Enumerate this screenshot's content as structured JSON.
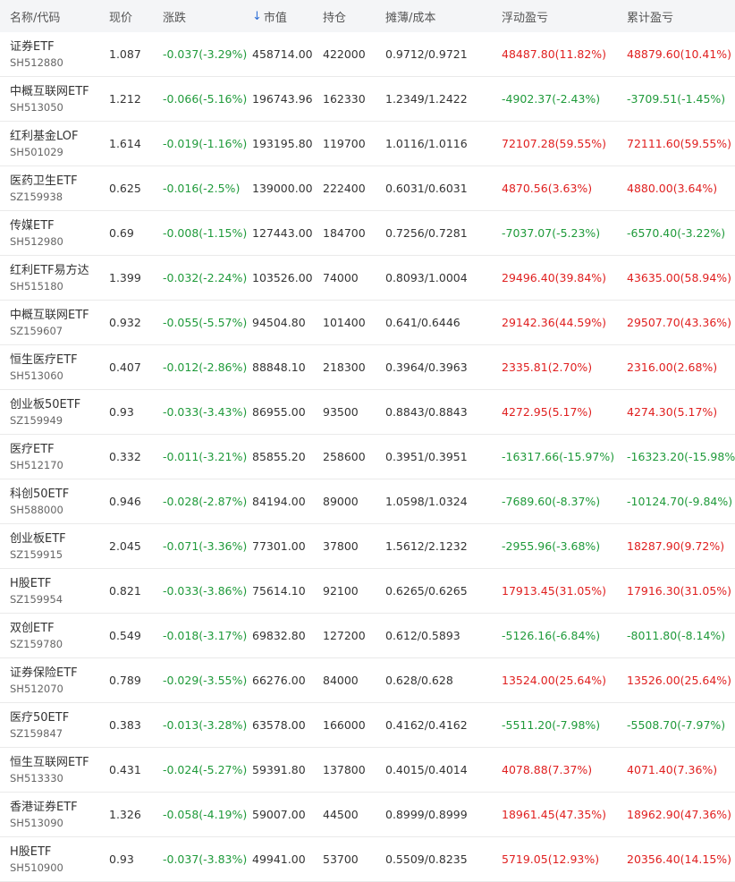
{
  "columns": [
    {
      "key": "name",
      "label": "名称/代码"
    },
    {
      "key": "price",
      "label": "现价"
    },
    {
      "key": "change",
      "label": "涨跌"
    },
    {
      "key": "market_value",
      "label": "市值"
    },
    {
      "key": "holding",
      "label": "持仓"
    },
    {
      "key": "cost",
      "label": "摊薄/成本"
    },
    {
      "key": "float_pnl",
      "label": "浮动盈亏"
    },
    {
      "key": "total_pnl",
      "label": "累计盈亏"
    }
  ],
  "sort": {
    "column": "market_value",
    "arrow": "↓"
  },
  "colors": {
    "up": "#e02020",
    "down": "#1f9a3a",
    "header_bg": "#f4f5f7"
  },
  "rows": [
    {
      "name": "证券ETF",
      "code": "SH512880",
      "price": "1.087",
      "change": "-0.037(-3.29%)",
      "market_value": "458714.00",
      "holding": "422000",
      "cost": "0.9712/0.9721",
      "float_pnl": "48487.80(11.82%)",
      "total_pnl": "48879.60(10.41%)"
    },
    {
      "name": "中概互联网ETF",
      "code": "SH513050",
      "price": "1.212",
      "change": "-0.066(-5.16%)",
      "market_value": "196743.96",
      "holding": "162330",
      "cost": "1.2349/1.2422",
      "float_pnl": "-4902.37(-2.43%)",
      "total_pnl": "-3709.51(-1.45%)"
    },
    {
      "name": "红利基金LOF",
      "code": "SH501029",
      "price": "1.614",
      "change": "-0.019(-1.16%)",
      "market_value": "193195.80",
      "holding": "119700",
      "cost": "1.0116/1.0116",
      "float_pnl": "72107.28(59.55%)",
      "total_pnl": "72111.60(59.55%)"
    },
    {
      "name": "医药卫生ETF",
      "code": "SZ159938",
      "price": "0.625",
      "change": "-0.016(-2.5%)",
      "market_value": "139000.00",
      "holding": "222400",
      "cost": "0.6031/0.6031",
      "float_pnl": "4870.56(3.63%)",
      "total_pnl": "4880.00(3.64%)"
    },
    {
      "name": "传媒ETF",
      "code": "SH512980",
      "price": "0.69",
      "change": "-0.008(-1.15%)",
      "market_value": "127443.00",
      "holding": "184700",
      "cost": "0.7256/0.7281",
      "float_pnl": "-7037.07(-5.23%)",
      "total_pnl": "-6570.40(-3.22%)"
    },
    {
      "name": "红利ETF易方达",
      "code": "SH515180",
      "price": "1.399",
      "change": "-0.032(-2.24%)",
      "market_value": "103526.00",
      "holding": "74000",
      "cost": "0.8093/1.0004",
      "float_pnl": "29496.40(39.84%)",
      "total_pnl": "43635.00(58.94%)"
    },
    {
      "name": "中概互联网ETF",
      "code": "SZ159607",
      "price": "0.932",
      "change": "-0.055(-5.57%)",
      "market_value": "94504.80",
      "holding": "101400",
      "cost": "0.641/0.6446",
      "float_pnl": "29142.36(44.59%)",
      "total_pnl": "29507.70(43.36%)"
    },
    {
      "name": "恒生医疗ETF",
      "code": "SH513060",
      "price": "0.407",
      "change": "-0.012(-2.86%)",
      "market_value": "88848.10",
      "holding": "218300",
      "cost": "0.3964/0.3963",
      "float_pnl": "2335.81(2.70%)",
      "total_pnl": "2316.00(2.68%)"
    },
    {
      "name": "创业板50ETF",
      "code": "SZ159949",
      "price": "0.93",
      "change": "-0.033(-3.43%)",
      "market_value": "86955.00",
      "holding": "93500",
      "cost": "0.8843/0.8843",
      "float_pnl": "4272.95(5.17%)",
      "total_pnl": "4274.30(5.17%)"
    },
    {
      "name": "医疗ETF",
      "code": "SH512170",
      "price": "0.332",
      "change": "-0.011(-3.21%)",
      "market_value": "85855.20",
      "holding": "258600",
      "cost": "0.3951/0.3951",
      "float_pnl": "-16317.66(-15.97%)",
      "total_pnl": "-16323.20(-15.98%)"
    },
    {
      "name": "科创50ETF",
      "code": "SH588000",
      "price": "0.946",
      "change": "-0.028(-2.87%)",
      "market_value": "84194.00",
      "holding": "89000",
      "cost": "1.0598/1.0324",
      "float_pnl": "-7689.60(-8.37%)",
      "total_pnl": "-10124.70(-9.84%)"
    },
    {
      "name": "创业板ETF",
      "code": "SZ159915",
      "price": "2.045",
      "change": "-0.071(-3.36%)",
      "market_value": "77301.00",
      "holding": "37800",
      "cost": "1.5612/2.1232",
      "float_pnl": "-2955.96(-3.68%)",
      "total_pnl": "18287.90(9.72%)"
    },
    {
      "name": "H股ETF",
      "code": "SZ159954",
      "price": "0.821",
      "change": "-0.033(-3.86%)",
      "market_value": "75614.10",
      "holding": "92100",
      "cost": "0.6265/0.6265",
      "float_pnl": "17913.45(31.05%)",
      "total_pnl": "17916.30(31.05%)"
    },
    {
      "name": "双创ETF",
      "code": "SZ159780",
      "price": "0.549",
      "change": "-0.018(-3.17%)",
      "market_value": "69832.80",
      "holding": "127200",
      "cost": "0.612/0.5893",
      "float_pnl": "-5126.16(-6.84%)",
      "total_pnl": "-8011.80(-8.14%)"
    },
    {
      "name": "证券保险ETF",
      "code": "SH512070",
      "price": "0.789",
      "change": "-0.029(-3.55%)",
      "market_value": "66276.00",
      "holding": "84000",
      "cost": "0.628/0.628",
      "float_pnl": "13524.00(25.64%)",
      "total_pnl": "13526.00(25.64%)"
    },
    {
      "name": "医疗50ETF",
      "code": "SZ159847",
      "price": "0.383",
      "change": "-0.013(-3.28%)",
      "market_value": "63578.00",
      "holding": "166000",
      "cost": "0.4162/0.4162",
      "float_pnl": "-5511.20(-7.98%)",
      "total_pnl": "-5508.70(-7.97%)"
    },
    {
      "name": "恒生互联网ETF",
      "code": "SH513330",
      "price": "0.431",
      "change": "-0.024(-5.27%)",
      "market_value": "59391.80",
      "holding": "137800",
      "cost": "0.4015/0.4014",
      "float_pnl": "4078.88(7.37%)",
      "total_pnl": "4071.40(7.36%)"
    },
    {
      "name": "香港证券ETF",
      "code": "SH513090",
      "price": "1.326",
      "change": "-0.058(-4.19%)",
      "market_value": "59007.00",
      "holding": "44500",
      "cost": "0.8999/0.8999",
      "float_pnl": "18961.45(47.35%)",
      "total_pnl": "18962.90(47.36%)"
    },
    {
      "name": "H股ETF",
      "code": "SH510900",
      "price": "0.93",
      "change": "-0.037(-3.83%)",
      "market_value": "49941.00",
      "holding": "53700",
      "cost": "0.5509/0.8235",
      "float_pnl": "5719.05(12.93%)",
      "total_pnl": "20356.40(14.15%)"
    }
  ]
}
